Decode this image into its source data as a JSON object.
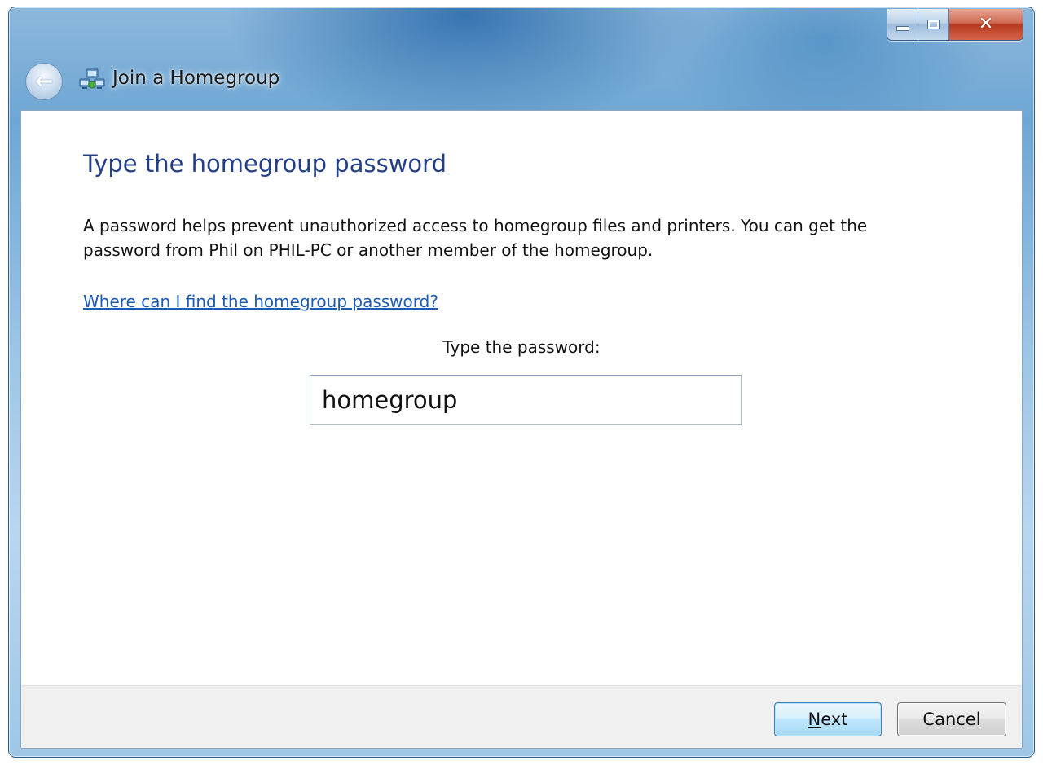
{
  "window": {
    "title": "Join a Homegroup",
    "minimize_icon": "minimize-icon",
    "maximize_icon": "maximize-icon",
    "close_icon": "close-icon",
    "back_icon": "back-arrow-icon",
    "app_icon": "homegroup-icon"
  },
  "page": {
    "heading": "Type the homegroup password",
    "description": "A password helps prevent unauthorized access to homegroup files and printers. You can get the password from Phil on PHIL-PC or another member of the homegroup.",
    "help_link": "Where can I find the homegroup password?",
    "password_label": "Type the password:",
    "password_value": "homegroup"
  },
  "footer": {
    "next_label_access_key": "N",
    "next_label_rest": "ext",
    "cancel_label": "Cancel"
  },
  "colors": {
    "heading": "#243f8a",
    "link": "#1c5bb5",
    "title_bar": "#6ea6d3",
    "close_button": "#c7472c",
    "default_button_border": "#3c7fb1"
  }
}
